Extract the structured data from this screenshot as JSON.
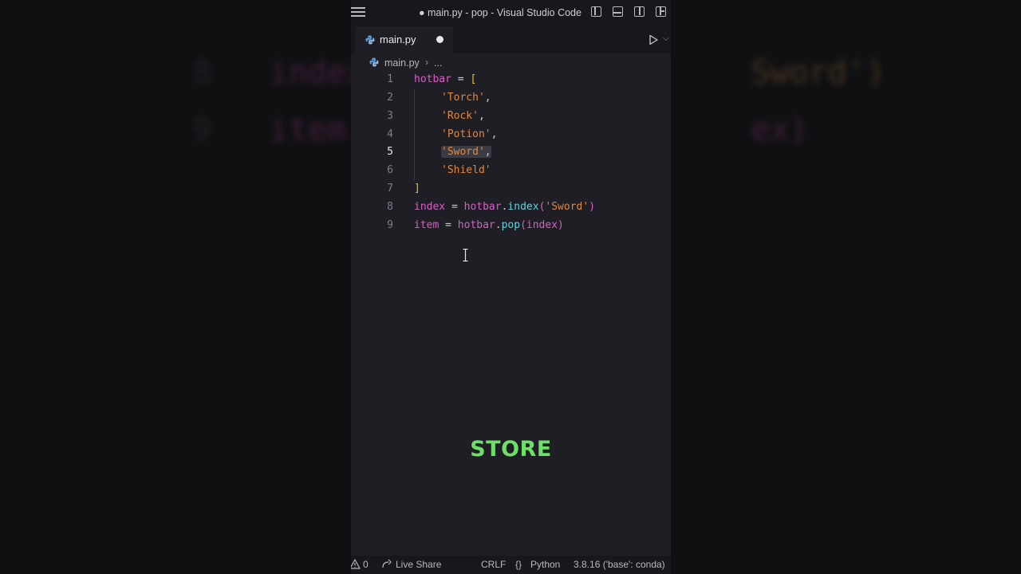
{
  "background_echo": {
    "line8": {
      "num": "8",
      "code_left": "index =",
      "code_right": "Sword')"
    },
    "line9": {
      "num": "9",
      "code_left": "item =",
      "code_right": "ex)"
    }
  },
  "window": {
    "title": "● main.py - pop - Visual Studio Code",
    "tab": {
      "label": "main.py"
    },
    "breadcrumb": {
      "file": "main.py",
      "separator": "›",
      "more": "..."
    }
  },
  "code_lines": [
    {
      "num": "1"
    },
    {
      "num": "2"
    },
    {
      "num": "3"
    },
    {
      "num": "4"
    },
    {
      "num": "5"
    },
    {
      "num": "6"
    },
    {
      "num": "7"
    },
    {
      "num": "8"
    },
    {
      "num": "9"
    }
  ],
  "tokens": {
    "l1": {
      "a": "hotbar",
      "b": " = ",
      "c": "["
    },
    "l2": {
      "a": "'Torch'",
      "b": ","
    },
    "l3": {
      "a": "'Rock'",
      "b": ","
    },
    "l4": {
      "a": "'Potion'",
      "b": ","
    },
    "l5": {
      "a": "'Sword'",
      "b": ","
    },
    "l6": {
      "a": "'Shield'"
    },
    "l7": {
      "a": "]"
    },
    "l8": {
      "a": "index",
      "b": " = ",
      "c": "hotbar",
      "d": ".",
      "e": "index",
      "f": "(",
      "g": "'Sword'",
      "h": ")"
    },
    "l9": {
      "a": "item",
      "b": " = ",
      "c": "hotbar",
      "d": ".",
      "e": "pop",
      "f": "(",
      "g": "index",
      "h": ")"
    }
  },
  "overlay": {
    "caption": "STORE"
  },
  "status": {
    "problems": "0",
    "live_share": "Live Share",
    "eol": "CRLF",
    "language": "Python",
    "interpreter": "3.8.16 ('base': conda)"
  },
  "colors": {
    "caption": "#6ee06a",
    "variable": "#d85fc6",
    "string": "#e0883e",
    "function": "#5fd3e0",
    "bracket": "#e0c23a"
  },
  "icons": [
    "menu-icon",
    "layout-icons",
    "python-file-icon",
    "run-icon",
    "warning-icon",
    "live-share-icon",
    "braces-icon",
    "text-cursor-icon"
  ]
}
